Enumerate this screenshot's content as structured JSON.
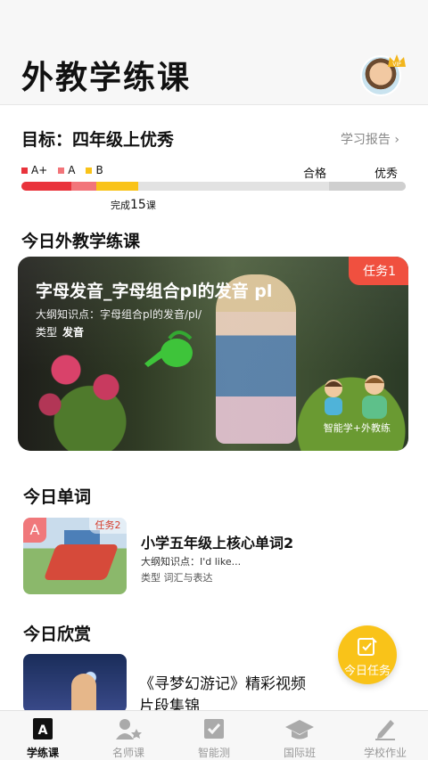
{
  "header": {
    "title": "外教学练课"
  },
  "goal": {
    "text": "目标：四年级上优秀",
    "report_link": "学习报告 ›"
  },
  "progress": {
    "legend": [
      {
        "label": "A+",
        "color": "#e9333b"
      },
      {
        "label": "A",
        "color": "#f2757a"
      },
      {
        "label": "B",
        "color": "#f9c319"
      }
    ],
    "pass_label": "合格",
    "excellent_label": "优秀",
    "completed_prefix": "完成",
    "completed_count": "15",
    "completed_suffix": "课",
    "segments": [
      {
        "color": "#e9333b",
        "fraction": 0.13
      },
      {
        "color": "#f2757a",
        "fraction": 0.065
      },
      {
        "color": "#f9c319",
        "fraction": 0.11
      },
      {
        "color": "#e2e2e2",
        "fraction": 0.495
      },
      {
        "color": "#cfcfcf",
        "fraction": 0.2
      }
    ]
  },
  "today_lesson": {
    "section_title": "今日外教学练课",
    "task_badge": "任务1",
    "title": "字母发音_字母组合pl的发音 pl",
    "knowledge": "大纲知识点：字母组合pl的发音/pl/",
    "type_label": "类型",
    "type_value": "发音",
    "teach_label": "智能学+外教练"
  },
  "today_words": {
    "section_title": "今日单词",
    "grade_badge": "A",
    "task_badge": "任务2",
    "title": "小学五年级上核心单词2",
    "knowledge": "大纲知识点：I'd like...",
    "type_label": "类型",
    "type_value": "词汇与表达"
  },
  "today_appreciation": {
    "section_title": "今日欣赏",
    "title_line1": "《寻梦幻游记》精彩视频",
    "title_line2": "片段集锦"
  },
  "fab": {
    "label": "今日任务"
  },
  "tabs": [
    {
      "label": "学练课",
      "icon": "practice-class-icon",
      "active": true
    },
    {
      "label": "名师课",
      "icon": "teacher-class-icon",
      "active": false
    },
    {
      "label": "智能测",
      "icon": "smart-test-icon",
      "active": false
    },
    {
      "label": "国际班",
      "icon": "graduation-cap-icon",
      "active": false
    },
    {
      "label": "学校作业",
      "icon": "pencil-icon",
      "active": false
    }
  ],
  "colors": {
    "accent_red": "#f0503f",
    "accent_yellow": "#f9c319"
  }
}
